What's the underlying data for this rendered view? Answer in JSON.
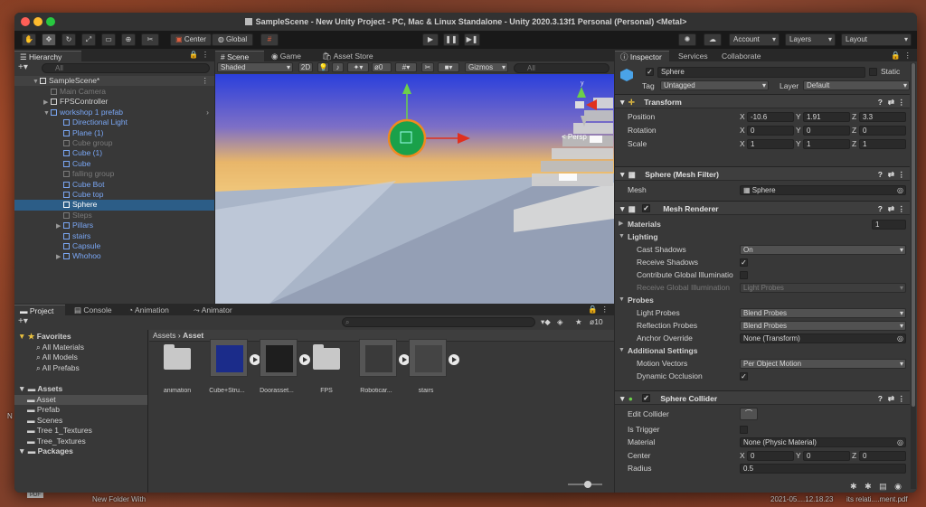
{
  "window_title": "SampleScene - New Unity Project - PC, Mac & Linux Standalone - Unity 2020.3.13f1 Personal (Personal) <Metal>",
  "toolbar": {
    "center": "Center",
    "global": "Global",
    "account": "Account",
    "layers": "Layers",
    "layout": "Layout"
  },
  "hierarchy": {
    "tab": "Hierarchy",
    "search_placeholder": "All",
    "scene": "SampleScene*",
    "items": [
      {
        "label": "Main Camera",
        "style": "dim",
        "indent": 2,
        "arrow": ""
      },
      {
        "label": "FPSController",
        "style": "",
        "indent": 2,
        "arrow": "▶"
      },
      {
        "label": "workshop 1 prefab",
        "style": "blue",
        "indent": 2,
        "arrow": "▼"
      },
      {
        "label": "Directional Light",
        "style": "blue",
        "indent": 3,
        "arrow": ""
      },
      {
        "label": "Plane (1)",
        "style": "blue",
        "indent": 3,
        "arrow": ""
      },
      {
        "label": "Cube group",
        "style": "dim",
        "indent": 3,
        "arrow": ""
      },
      {
        "label": "Cube (1)",
        "style": "blue",
        "indent": 3,
        "arrow": ""
      },
      {
        "label": "Cube",
        "style": "blue",
        "indent": 3,
        "arrow": ""
      },
      {
        "label": "falling group",
        "style": "dim",
        "indent": 3,
        "arrow": ""
      },
      {
        "label": "Cube Bot",
        "style": "blue",
        "indent": 3,
        "arrow": ""
      },
      {
        "label": "Cube top",
        "style": "blue",
        "indent": 3,
        "arrow": ""
      },
      {
        "label": "Sphere",
        "style": "selected",
        "indent": 3,
        "arrow": ""
      },
      {
        "label": "Steps",
        "style": "dim",
        "indent": 3,
        "arrow": ""
      },
      {
        "label": "Pillars",
        "style": "blue",
        "indent": 3,
        "arrow": "▶"
      },
      {
        "label": "stairs",
        "style": "blue",
        "indent": 3,
        "arrow": ""
      },
      {
        "label": "Capsule",
        "style": "blue",
        "indent": 3,
        "arrow": ""
      },
      {
        "label": "Whohoo",
        "style": "blue",
        "indent": 3,
        "arrow": "▶"
      }
    ]
  },
  "scene_view": {
    "tabs": [
      "Scene",
      "Game",
      "Asset Store"
    ],
    "shading": "Shaded",
    "mode_2d": "2D",
    "fx_count": "0",
    "gizmos": "Gizmos",
    "search_placeholder": "All",
    "persp": "< Persp"
  },
  "project": {
    "tabs": [
      "Project",
      "Console",
      "Animation",
      "Animator"
    ],
    "hidden_count": "10",
    "tree": [
      {
        "label": "Favorites",
        "indent": 0,
        "type": "star",
        "bold": true
      },
      {
        "label": "All Materials",
        "indent": 2,
        "type": "search"
      },
      {
        "label": "All Models",
        "indent": 2,
        "type": "search"
      },
      {
        "label": "All Prefabs",
        "indent": 2,
        "type": "search"
      },
      {
        "label": "",
        "indent": 0,
        "type": "gap"
      },
      {
        "label": "Assets",
        "indent": 0,
        "type": "folder",
        "bold": true
      },
      {
        "label": "Asset",
        "indent": 1,
        "type": "folder",
        "selected": true
      },
      {
        "label": "Prefab",
        "indent": 1,
        "type": "folder"
      },
      {
        "label": "Scenes",
        "indent": 1,
        "type": "folder"
      },
      {
        "label": "Tree 1_Textures",
        "indent": 1,
        "type": "folder"
      },
      {
        "label": "Tree_Textures",
        "indent": 1,
        "type": "folder"
      },
      {
        "label": "Packages",
        "indent": 0,
        "type": "folder",
        "bold": true
      }
    ],
    "breadcrumb": [
      "Assets",
      "Asset"
    ],
    "files": [
      "animation",
      "Cube+Stru...",
      "Doorasset...",
      "FPS",
      "Roboticar...",
      "stairs"
    ]
  },
  "inspector": {
    "tabs": [
      "Inspector",
      "Services",
      "Collaborate"
    ],
    "object_name": "Sphere",
    "static": "Static",
    "tag_label": "Tag",
    "tag_value": "Untagged",
    "layer_label": "Layer",
    "layer_value": "Default",
    "transform": {
      "title": "Transform",
      "position_label": "Position",
      "rotation_label": "Rotation",
      "scale_label": "Scale",
      "position": {
        "x": "-10.6",
        "y": "1.91",
        "z": "3.3"
      },
      "rotation": {
        "x": "0",
        "y": "0",
        "z": "0"
      },
      "scale": {
        "x": "1",
        "y": "1",
        "z": "1"
      }
    },
    "mesh_filter": {
      "title": "Sphere (Mesh Filter)",
      "mesh_label": "Mesh",
      "mesh_value": "Sphere"
    },
    "mesh_renderer": {
      "title": "Mesh Renderer",
      "materials_label": "Materials",
      "materials_count": "1",
      "lighting": "Lighting",
      "cast_shadows_label": "Cast Shadows",
      "cast_shadows": "On",
      "receive_shadows_label": "Receive Shadows",
      "contribute_gi_label": "Contribute Global Illuminatio",
      "receive_gi_label": "Receive Global Illumination",
      "receive_gi": "Light Probes",
      "probes": "Probes",
      "light_probes_label": "Light Probes",
      "light_probes": "Blend Probes",
      "reflection_probes_label": "Reflection Probes",
      "reflection_probes": "Blend Probes",
      "anchor_override_label": "Anchor Override",
      "anchor_override": "None (Transform)",
      "additional_settings": "Additional Settings",
      "motion_vectors_label": "Motion Vectors",
      "motion_vectors": "Per Object Motion",
      "dynamic_occlusion_label": "Dynamic Occlusion"
    },
    "sphere_collider": {
      "title": "Sphere Collider",
      "edit_collider_label": "Edit Collider",
      "is_trigger_label": "Is Trigger",
      "material_label": "Material",
      "material": "None (Physic Material)",
      "center_label": "Center",
      "center": {
        "x": "0",
        "y": "0",
        "z": "0"
      },
      "radius_label": "Radius",
      "radius": "0.5"
    }
  },
  "desktop": {
    "new_folder": "New Folder With",
    "pdf_badge": "PDF",
    "left_n": "N",
    "file1": "2021-05....12.18.23",
    "file2": "its relati....ment.pdf"
  },
  "colors": {
    "accent_blue": "#7aa7f5",
    "selection": "#2c5d87",
    "close": "#ff5f57",
    "minimize": "#febc2e",
    "zoom": "#28c840"
  }
}
